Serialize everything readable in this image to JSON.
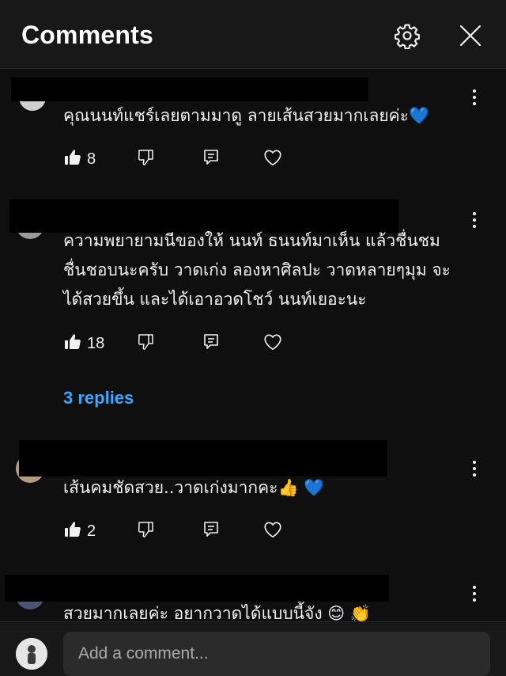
{
  "header": {
    "title": "Comments",
    "settings_icon": "gear-icon",
    "close_icon": "close-icon"
  },
  "comments": [
    {
      "text_lines": [
        "คุณนนท์แชร์เลยตามมาดู ลายเส้นสวยมากเลยค่ะ💙"
      ],
      "likes": "8"
    },
    {
      "text_lines": [
        "ความพยายามนีของให้ นนท์ ธนนท์มาเห็น แล้วชื่นชม",
        "ชื่นชอบนะครับ วาดเก่ง ลองหาศิลปะ วาดหลายๆมุม  จะ",
        "ได้สวยขึ้น และได้เอาอวดโชว์ นนท์เยอะนะ"
      ],
      "likes": "18",
      "replies_label": "3 replies"
    },
    {
      "text_lines": [
        "เส้นคมชัดสวย..วาดเก่งมากคะ👍 💙"
      ],
      "likes": "2"
    },
    {
      "text_lines": [
        "สวยมากเลยค่ะ อยากวาดได้แบบนี้จัง 😊 👏"
      ]
    }
  ],
  "footer": {
    "placeholder": "Add a comment..."
  },
  "colors": {
    "background": "#0f0f0f",
    "header": "#181818",
    "link": "#3ea6ff",
    "input": "#2b2b2b"
  }
}
